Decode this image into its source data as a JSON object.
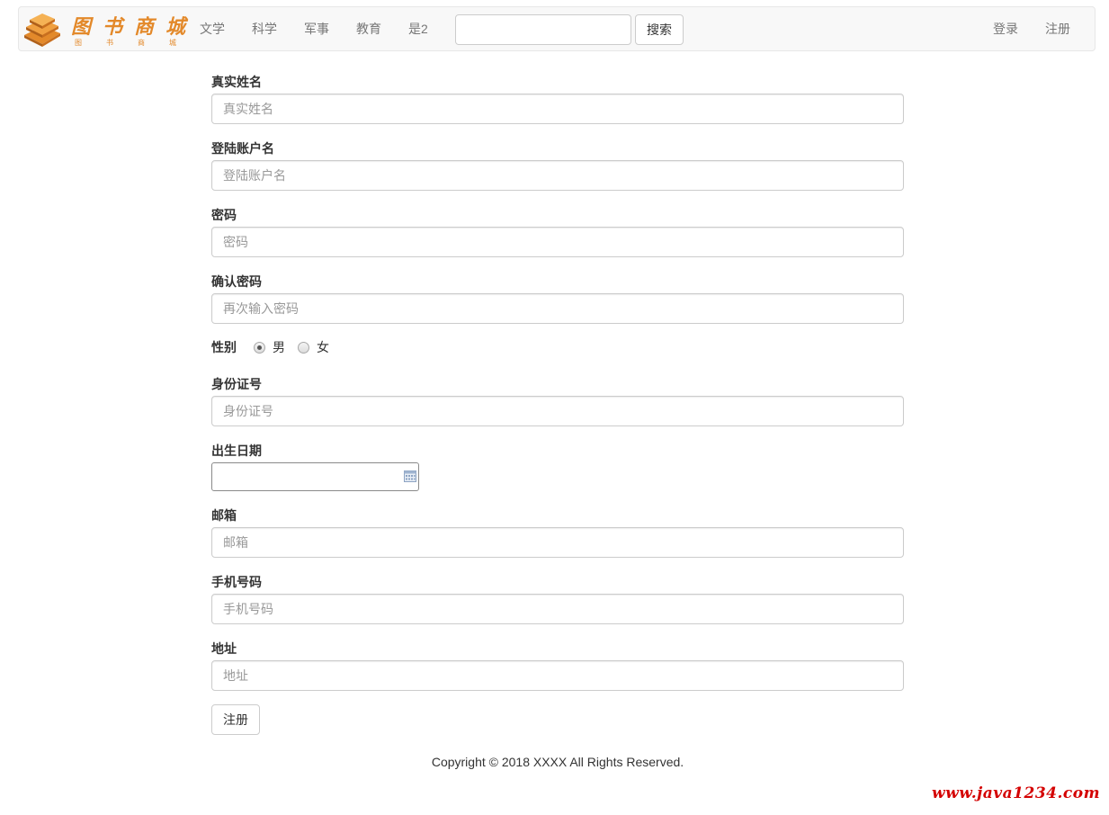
{
  "brand": {
    "logo_chars": [
      "图",
      "书",
      "商",
      "城"
    ],
    "logo_subchars": [
      "图",
      "书",
      "商",
      "城"
    ],
    "accent_color": "#e3892a"
  },
  "nav": {
    "items": [
      {
        "label": "文学"
      },
      {
        "label": "科学"
      },
      {
        "label": "军事"
      },
      {
        "label": "教育"
      },
      {
        "label": "是2"
      }
    ],
    "search_placeholder": "",
    "search_button": "搜索",
    "login": "登录",
    "register": "注册"
  },
  "form": {
    "real_name": {
      "label": "真实姓名",
      "placeholder": "真实姓名"
    },
    "username": {
      "label": "登陆账户名",
      "placeholder": "登陆账户名"
    },
    "password": {
      "label": "密码",
      "placeholder": "密码"
    },
    "confirm_password": {
      "label": "确认密码",
      "placeholder": "再次输入密码"
    },
    "gender": {
      "label": "性别",
      "options": [
        "男",
        "女"
      ],
      "selected": "男"
    },
    "id_number": {
      "label": "身份证号",
      "placeholder": "身份证号"
    },
    "birth_date": {
      "label": "出生日期",
      "value": ""
    },
    "email": {
      "label": "邮箱",
      "placeholder": "邮箱"
    },
    "phone": {
      "label": "手机号码",
      "placeholder": "手机号码"
    },
    "address": {
      "label": "地址",
      "placeholder": "地址"
    },
    "submit": "注册"
  },
  "footer": {
    "copyright": "Copyright © 2018 XXXX All Rights Reserved."
  },
  "watermark": "www.java1234.com"
}
